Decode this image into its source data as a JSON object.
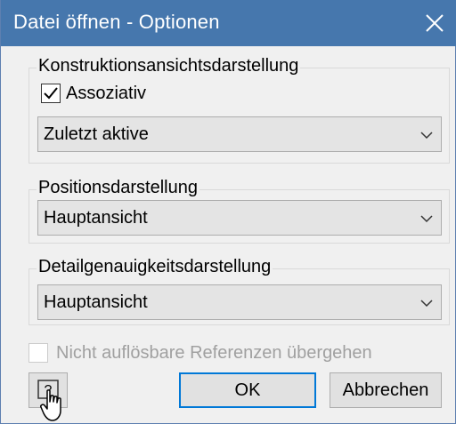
{
  "window": {
    "title": "Datei öffnen - Optionen",
    "close_icon": "close-icon"
  },
  "group1": {
    "label": "Konstruktionsansichtsdarstellung",
    "checkbox": {
      "label": "Assoziativ",
      "checked": true
    },
    "select": {
      "value": "Zuletzt aktive"
    }
  },
  "group2": {
    "label": "Positionsdarstellung",
    "select": {
      "value": "Hauptansicht"
    }
  },
  "group3": {
    "label": "Detailgenauigkeitsdarstellung",
    "select": {
      "value": "Hauptansicht"
    }
  },
  "skip_refs": {
    "label": "Nicht auflösbare Referenzen übergehen",
    "checked": false,
    "enabled": false
  },
  "buttons": {
    "help_icon": "help-icon",
    "ok": "OK",
    "cancel": "Abbrechen"
  },
  "colors": {
    "titlebar": "#4677ad",
    "accent": "#0078d7"
  }
}
